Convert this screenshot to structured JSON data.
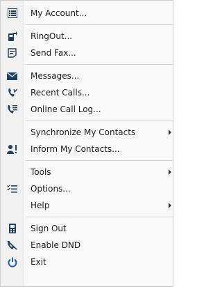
{
  "menu": {
    "items": [
      {
        "label": "My Account...",
        "icon": "account-card-icon"
      },
      {
        "label": "RingOut...",
        "icon": "ringout-phone-icon"
      },
      {
        "label": "Send Fax...",
        "icon": "fax-icon"
      },
      {
        "label": "Messages...",
        "icon": "envelope-icon"
      },
      {
        "label": "Recent Calls...",
        "icon": "recent-calls-icon"
      },
      {
        "label": "Online Call Log...",
        "icon": "call-log-icon"
      },
      {
        "label": "Synchronize My Contacts",
        "icon": "",
        "submenu": true
      },
      {
        "label": "Inform My Contacts...",
        "icon": "inform-contacts-icon"
      },
      {
        "label": "Tools",
        "icon": "",
        "submenu": true
      },
      {
        "label": "Options...",
        "icon": "options-icon"
      },
      {
        "label": "Help",
        "icon": "",
        "submenu": true
      },
      {
        "label": "Sign Out",
        "icon": "sign-out-icon"
      },
      {
        "label": "Enable DND",
        "icon": "dnd-icon"
      },
      {
        "label": "Exit",
        "icon": "power-icon"
      }
    ]
  },
  "colors": {
    "icon": "#1f3f5f",
    "power": "#1f5fa8",
    "separator": "#d4d4d4"
  }
}
